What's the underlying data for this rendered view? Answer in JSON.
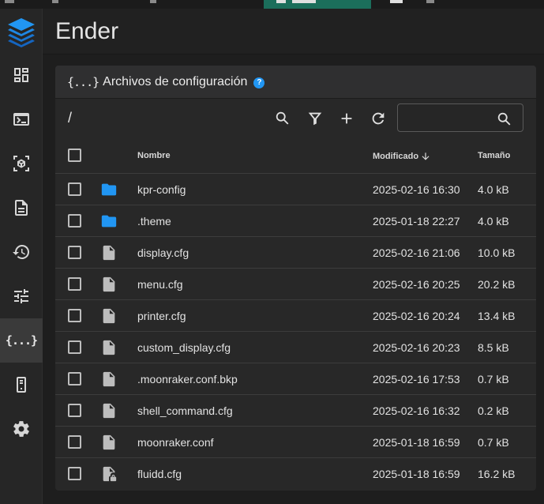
{
  "app": {
    "title": "Ender"
  },
  "sidebar": {
    "items": [
      {
        "name": "dashboard",
        "icon": "dashboard-icon"
      },
      {
        "name": "console",
        "icon": "console-icon"
      },
      {
        "name": "preview",
        "icon": "cube-scan-icon"
      },
      {
        "name": "jobs",
        "icon": "file-document-icon"
      },
      {
        "name": "history",
        "icon": "history-icon"
      },
      {
        "name": "tune",
        "icon": "tune-icon"
      },
      {
        "name": "configuration",
        "icon": "code-braces-icon",
        "label": "{...}",
        "active": true
      },
      {
        "name": "system",
        "icon": "server-icon"
      },
      {
        "name": "settings",
        "icon": "gear-icon"
      }
    ]
  },
  "card": {
    "braces": "{...}",
    "title": "Archivos de configuración",
    "help": "?",
    "path": "/",
    "search": {
      "value": "",
      "placeholder": ""
    }
  },
  "table": {
    "headers": {
      "name": "Nombre",
      "modified": "Modificado",
      "size": "Tamaño"
    },
    "rows": [
      {
        "name": "kpr-config",
        "modified": "2025-02-16 16:30",
        "size": "4.0 kB",
        "icon": "folder-icon"
      },
      {
        "name": ".theme",
        "modified": "2025-01-18 22:27",
        "size": "4.0 kB",
        "icon": "folder-icon"
      },
      {
        "name": "display.cfg",
        "modified": "2025-02-16 21:06",
        "size": "10.0 kB",
        "icon": "file-icon"
      },
      {
        "name": "menu.cfg",
        "modified": "2025-02-16 20:25",
        "size": "20.2 kB",
        "icon": "file-icon"
      },
      {
        "name": "printer.cfg",
        "modified": "2025-02-16 20:24",
        "size": "13.4 kB",
        "icon": "file-icon"
      },
      {
        "name": "custom_display.cfg",
        "modified": "2025-02-16 20:23",
        "size": "8.5 kB",
        "icon": "file-icon"
      },
      {
        "name": ".moonraker.conf.bkp",
        "modified": "2025-02-16 17:53",
        "size": "0.7 kB",
        "icon": "file-icon"
      },
      {
        "name": "shell_command.cfg",
        "modified": "2025-02-16 16:32",
        "size": "0.2 kB",
        "icon": "file-icon"
      },
      {
        "name": "moonraker.conf",
        "modified": "2025-01-18 16:59",
        "size": "0.7 kB",
        "icon": "file-icon"
      },
      {
        "name": "fluidd.cfg",
        "modified": "2025-01-18 16:59",
        "size": "16.2 kB",
        "icon": "file-lock-icon"
      }
    ]
  },
  "colors": {
    "accent": "#2196f3",
    "folder": "#2196f3",
    "file": "#bdbdbd",
    "active_tab": "#1b6e5b"
  }
}
